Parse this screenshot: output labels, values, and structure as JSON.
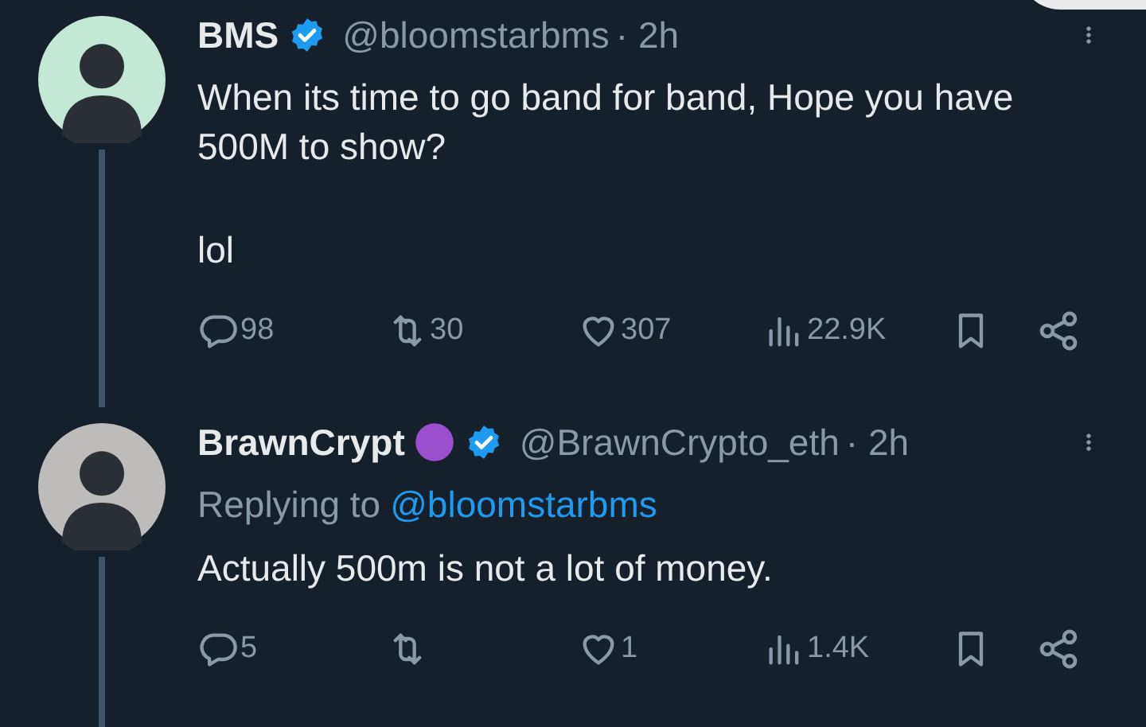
{
  "tweets": [
    {
      "name": "BMS",
      "emoji_badge": false,
      "verified": true,
      "handle": "@bloomstarbms",
      "time": "· 2h",
      "avatar": {
        "color": "#c4e8d6"
      },
      "paragraphs": [
        "When its time to go band for band, Hope you have 500M to show?",
        "lol"
      ],
      "stats": {
        "replies": "98",
        "reposts": "30",
        "likes": "307",
        "views": "22.9K"
      }
    },
    {
      "name": "BrawnCrypt",
      "emoji_badge": true,
      "verified": true,
      "handle": "@BrawnCrypto_eth",
      "time": "· 2h",
      "avatar": {
        "color": "#bdbcba"
      },
      "replying": {
        "prefix": "Replying to",
        "handle": "@bloomstarbms"
      },
      "paragraphs": [
        "Actually 500m is not a lot of money."
      ],
      "stats": {
        "replies": "5",
        "likes": "1",
        "views": "1.4K"
      }
    }
  ]
}
